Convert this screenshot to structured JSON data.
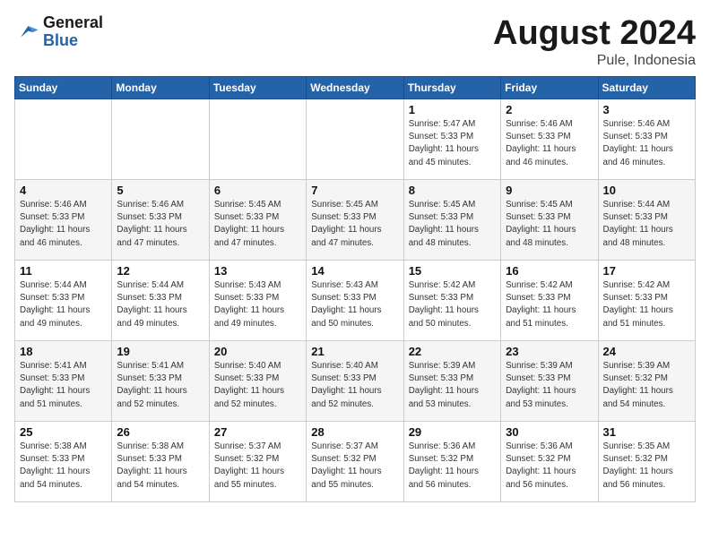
{
  "header": {
    "logo_general": "General",
    "logo_blue": "Blue",
    "month_title": "August 2024",
    "location": "Pule, Indonesia"
  },
  "weekdays": [
    "Sunday",
    "Monday",
    "Tuesday",
    "Wednesday",
    "Thursday",
    "Friday",
    "Saturday"
  ],
  "weeks": [
    [
      {
        "day": "",
        "info": ""
      },
      {
        "day": "",
        "info": ""
      },
      {
        "day": "",
        "info": ""
      },
      {
        "day": "",
        "info": ""
      },
      {
        "day": "1",
        "info": "Sunrise: 5:47 AM\nSunset: 5:33 PM\nDaylight: 11 hours\nand 45 minutes."
      },
      {
        "day": "2",
        "info": "Sunrise: 5:46 AM\nSunset: 5:33 PM\nDaylight: 11 hours\nand 46 minutes."
      },
      {
        "day": "3",
        "info": "Sunrise: 5:46 AM\nSunset: 5:33 PM\nDaylight: 11 hours\nand 46 minutes."
      }
    ],
    [
      {
        "day": "4",
        "info": "Sunrise: 5:46 AM\nSunset: 5:33 PM\nDaylight: 11 hours\nand 46 minutes."
      },
      {
        "day": "5",
        "info": "Sunrise: 5:46 AM\nSunset: 5:33 PM\nDaylight: 11 hours\nand 47 minutes."
      },
      {
        "day": "6",
        "info": "Sunrise: 5:45 AM\nSunset: 5:33 PM\nDaylight: 11 hours\nand 47 minutes."
      },
      {
        "day": "7",
        "info": "Sunrise: 5:45 AM\nSunset: 5:33 PM\nDaylight: 11 hours\nand 47 minutes."
      },
      {
        "day": "8",
        "info": "Sunrise: 5:45 AM\nSunset: 5:33 PM\nDaylight: 11 hours\nand 48 minutes."
      },
      {
        "day": "9",
        "info": "Sunrise: 5:45 AM\nSunset: 5:33 PM\nDaylight: 11 hours\nand 48 minutes."
      },
      {
        "day": "10",
        "info": "Sunrise: 5:44 AM\nSunset: 5:33 PM\nDaylight: 11 hours\nand 48 minutes."
      }
    ],
    [
      {
        "day": "11",
        "info": "Sunrise: 5:44 AM\nSunset: 5:33 PM\nDaylight: 11 hours\nand 49 minutes."
      },
      {
        "day": "12",
        "info": "Sunrise: 5:44 AM\nSunset: 5:33 PM\nDaylight: 11 hours\nand 49 minutes."
      },
      {
        "day": "13",
        "info": "Sunrise: 5:43 AM\nSunset: 5:33 PM\nDaylight: 11 hours\nand 49 minutes."
      },
      {
        "day": "14",
        "info": "Sunrise: 5:43 AM\nSunset: 5:33 PM\nDaylight: 11 hours\nand 50 minutes."
      },
      {
        "day": "15",
        "info": "Sunrise: 5:42 AM\nSunset: 5:33 PM\nDaylight: 11 hours\nand 50 minutes."
      },
      {
        "day": "16",
        "info": "Sunrise: 5:42 AM\nSunset: 5:33 PM\nDaylight: 11 hours\nand 51 minutes."
      },
      {
        "day": "17",
        "info": "Sunrise: 5:42 AM\nSunset: 5:33 PM\nDaylight: 11 hours\nand 51 minutes."
      }
    ],
    [
      {
        "day": "18",
        "info": "Sunrise: 5:41 AM\nSunset: 5:33 PM\nDaylight: 11 hours\nand 51 minutes."
      },
      {
        "day": "19",
        "info": "Sunrise: 5:41 AM\nSunset: 5:33 PM\nDaylight: 11 hours\nand 52 minutes."
      },
      {
        "day": "20",
        "info": "Sunrise: 5:40 AM\nSunset: 5:33 PM\nDaylight: 11 hours\nand 52 minutes."
      },
      {
        "day": "21",
        "info": "Sunrise: 5:40 AM\nSunset: 5:33 PM\nDaylight: 11 hours\nand 52 minutes."
      },
      {
        "day": "22",
        "info": "Sunrise: 5:39 AM\nSunset: 5:33 PM\nDaylight: 11 hours\nand 53 minutes."
      },
      {
        "day": "23",
        "info": "Sunrise: 5:39 AM\nSunset: 5:33 PM\nDaylight: 11 hours\nand 53 minutes."
      },
      {
        "day": "24",
        "info": "Sunrise: 5:39 AM\nSunset: 5:32 PM\nDaylight: 11 hours\nand 54 minutes."
      }
    ],
    [
      {
        "day": "25",
        "info": "Sunrise: 5:38 AM\nSunset: 5:33 PM\nDaylight: 11 hours\nand 54 minutes."
      },
      {
        "day": "26",
        "info": "Sunrise: 5:38 AM\nSunset: 5:33 PM\nDaylight: 11 hours\nand 54 minutes."
      },
      {
        "day": "27",
        "info": "Sunrise: 5:37 AM\nSunset: 5:32 PM\nDaylight: 11 hours\nand 55 minutes."
      },
      {
        "day": "28",
        "info": "Sunrise: 5:37 AM\nSunset: 5:32 PM\nDaylight: 11 hours\nand 55 minutes."
      },
      {
        "day": "29",
        "info": "Sunrise: 5:36 AM\nSunset: 5:32 PM\nDaylight: 11 hours\nand 56 minutes."
      },
      {
        "day": "30",
        "info": "Sunrise: 5:36 AM\nSunset: 5:32 PM\nDaylight: 11 hours\nand 56 minutes."
      },
      {
        "day": "31",
        "info": "Sunrise: 5:35 AM\nSunset: 5:32 PM\nDaylight: 11 hours\nand 56 minutes."
      }
    ]
  ]
}
